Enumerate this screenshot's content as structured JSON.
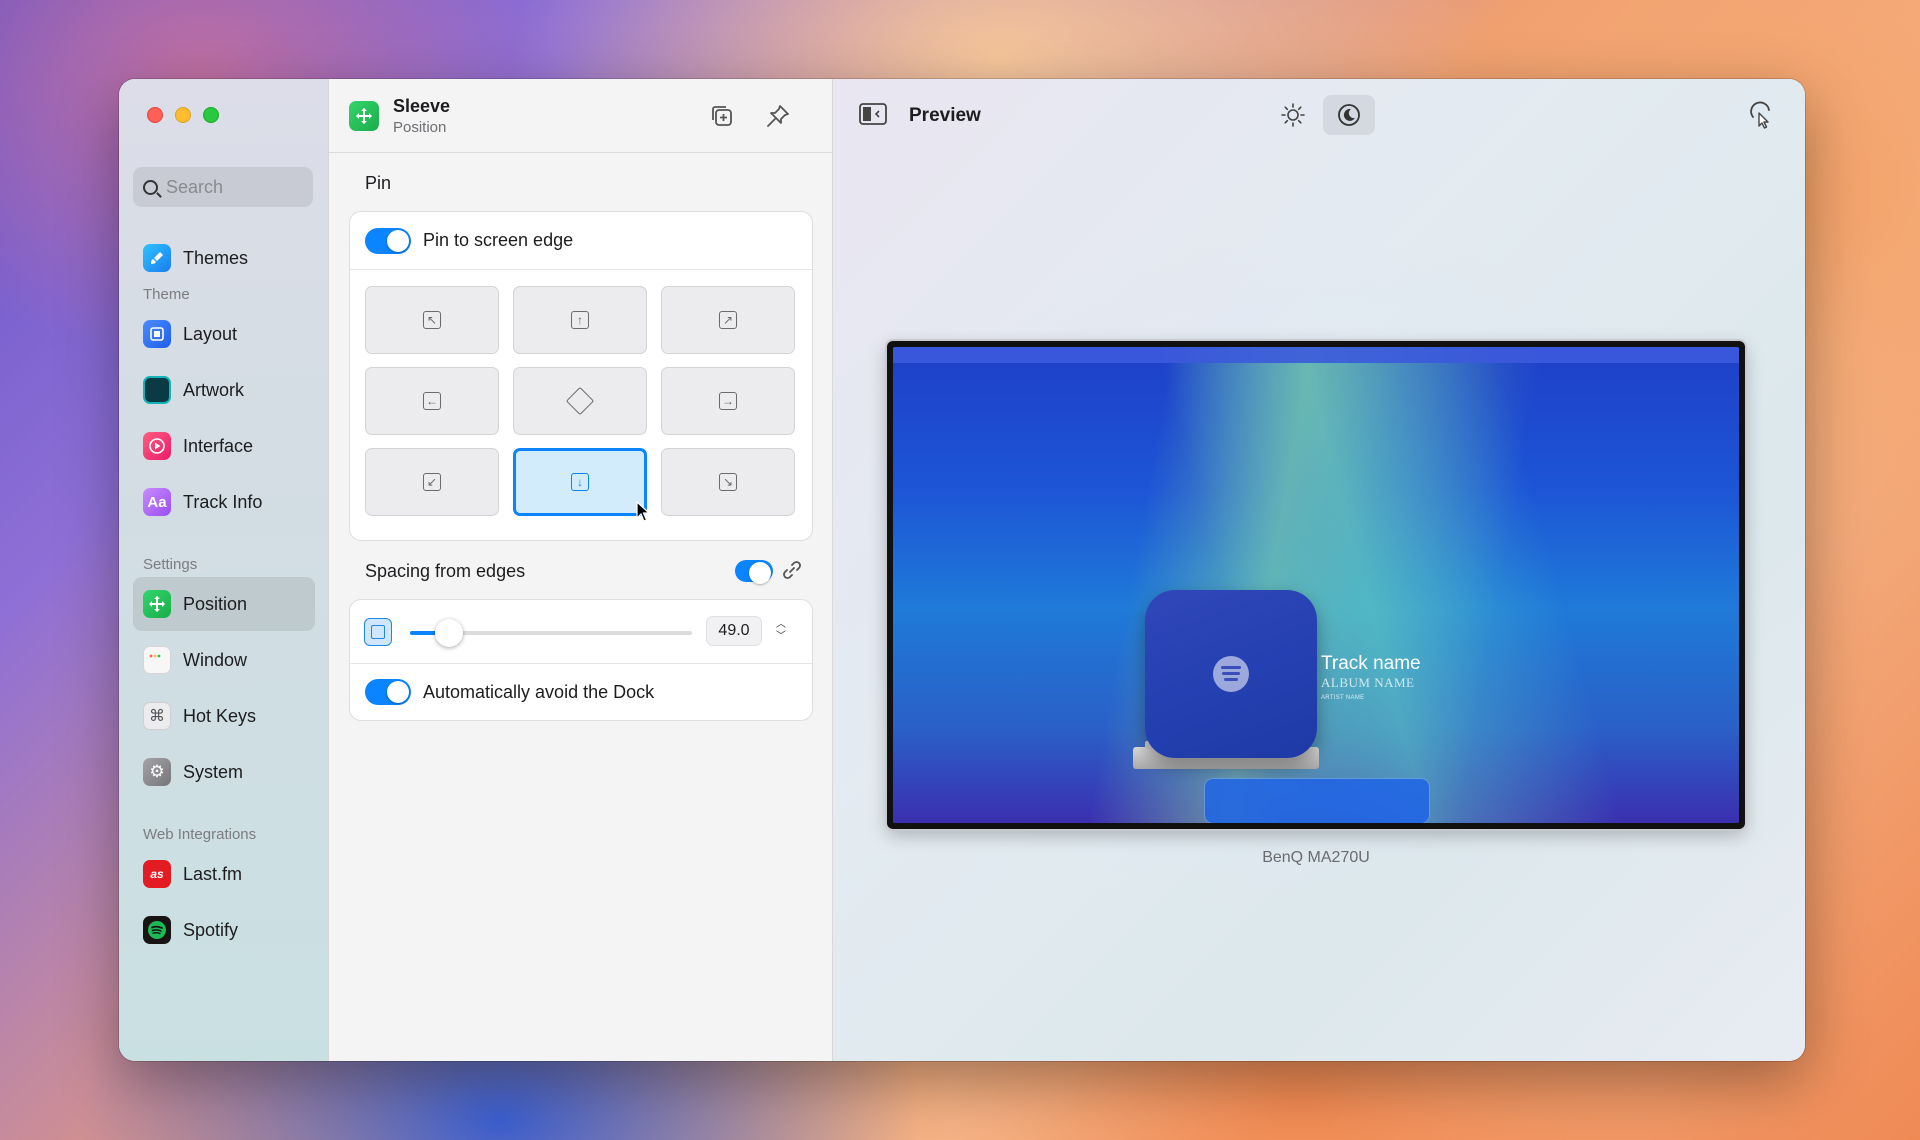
{
  "sidebar": {
    "search_placeholder": "Search",
    "top_item": {
      "label": "Themes",
      "icon": "paintbrush-icon",
      "color": "#1aa3ff"
    },
    "sections": [
      {
        "title": "Theme",
        "items": [
          {
            "label": "Layout",
            "icon": "layout-icon",
            "color": "#2d6df6"
          },
          {
            "label": "Artwork",
            "icon": "artwork-icon",
            "color": "#0c8a8a"
          },
          {
            "label": "Interface",
            "icon": "play-icon",
            "color": "#f0367a"
          },
          {
            "label": "Track Info",
            "icon": "text-icon",
            "color": "#b36cf6"
          }
        ]
      },
      {
        "title": "Settings",
        "items": [
          {
            "label": "Position",
            "icon": "move-icon",
            "color": "#22c35c",
            "active": true
          },
          {
            "label": "Window",
            "icon": "window-icon",
            "color": "#f2f2f2"
          },
          {
            "label": "Hot Keys",
            "icon": "command-icon",
            "color": "#e8e8ea"
          },
          {
            "label": "System",
            "icon": "gear-icon",
            "color": "#8e8e93"
          }
        ]
      },
      {
        "title": "Web Integrations",
        "items": [
          {
            "label": "Last.fm",
            "icon": "lastfm-icon",
            "color": "#e31b23"
          },
          {
            "label": "Spotify",
            "icon": "spotify-icon",
            "color": "#1db954"
          }
        ]
      }
    ]
  },
  "middle": {
    "app_name": "Sleeve",
    "subtitle": "Position",
    "pin_section": "Pin",
    "pin_toggle_label": "Pin to screen edge",
    "pin_toggle_on": true,
    "selected_cell": "bottom-center",
    "spacing_section": "Spacing from edges",
    "spacing_toggle_on": true,
    "spacing_value": "49.0",
    "spacing_fraction": 0.14,
    "avoid_dock_label": "Automatically avoid the Dock",
    "avoid_dock_on": true
  },
  "preview": {
    "title": "Preview",
    "monitor_name": "BenQ MA270U",
    "track_name": "Track name",
    "album_name": "ALBUM NAME",
    "artist_name": "ARTIST NAME",
    "active_mode": "dark"
  }
}
